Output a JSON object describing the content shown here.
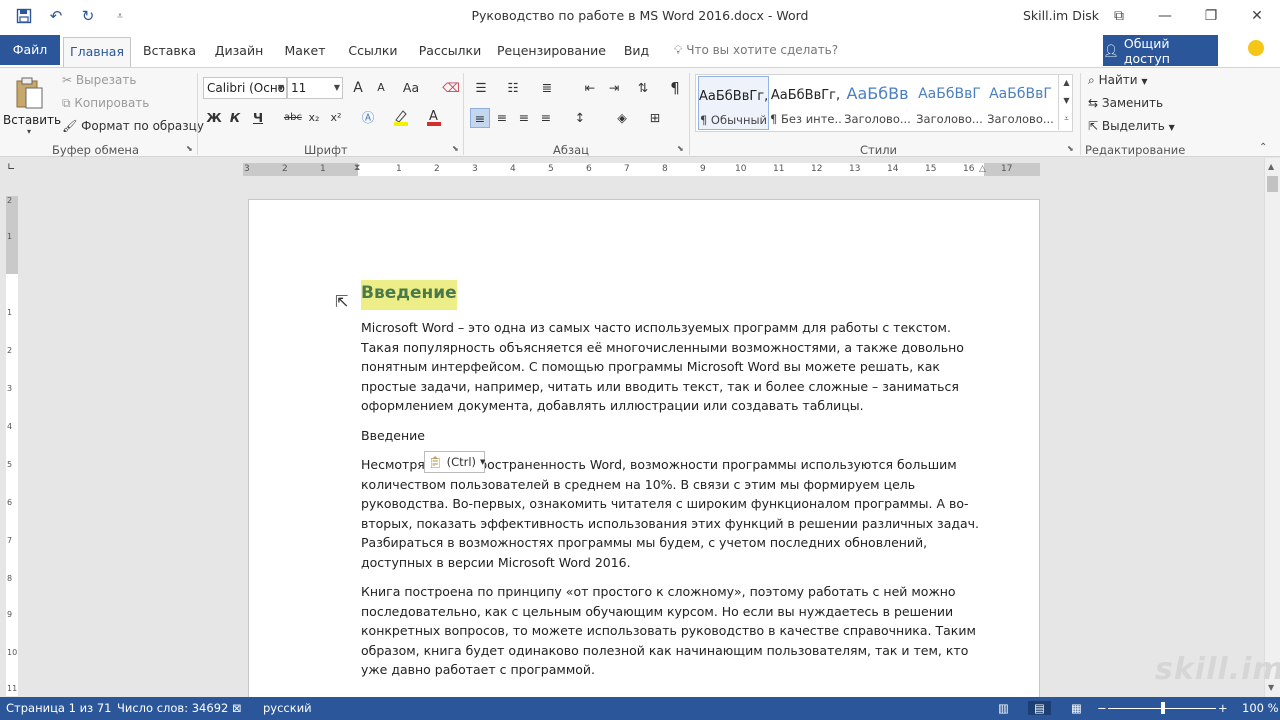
{
  "window": {
    "title": "Руководство по работе в MS Word 2016.docx - Word",
    "account": "Skill.im Disk",
    "controls": [
      "⧉",
      "—",
      "❐",
      "✕"
    ]
  },
  "qat": [
    "save-icon",
    "undo-icon",
    "redo-icon",
    "customize-icon"
  ],
  "tabs": {
    "file": "Файл",
    "home": "Главная",
    "insert": "Вставка",
    "design": "Дизайн",
    "layout": "Макет",
    "references": "Ссылки",
    "mailings": "Рассылки",
    "review": "Рецензирование",
    "view": "Вид",
    "tellme": "Что вы хотите сделать?",
    "share": "Общий доступ"
  },
  "clipboard": {
    "paste": "Вставить",
    "cut": "Вырезать",
    "copy": "Копировать",
    "format_painter": "Формат по образцу",
    "label": "Буфер обмена"
  },
  "font": {
    "name": "Calibri (Осно",
    "size": "11",
    "bold": "Ж",
    "italic": "К",
    "underline": "Ч",
    "strike": "abc",
    "subscript": "x₂",
    "superscript": "x²",
    "grow": "A",
    "shrink": "A",
    "case": "Aa",
    "label": "Шрифт"
  },
  "paragraph": {
    "label": "Абзац",
    "pilcrow": "¶"
  },
  "styles": {
    "label": "Стили",
    "items": [
      {
        "preview": "АаБбВвГг,",
        "name": "¶ Обычный"
      },
      {
        "preview": "АаБбВвГг,",
        "name": "¶ Без инте..."
      },
      {
        "preview": "АаБбВв",
        "name": "Заголово..."
      },
      {
        "preview": "АаБбВвГ",
        "name": "Заголово..."
      },
      {
        "preview": "АаБбВвГ",
        "name": "Заголово..."
      }
    ]
  },
  "editing": {
    "find": "Найти",
    "replace": "Заменить",
    "select": "Выделить",
    "label": "Редактирование"
  },
  "ruler": {
    "numbers": [
      "3",
      "2",
      "1",
      "1",
      "2",
      "3",
      "4",
      "5",
      "6",
      "7",
      "8",
      "9",
      "10",
      "11",
      "12",
      "13",
      "14",
      "15",
      "16",
      "17"
    ],
    "vnumbers": [
      "2",
      "1",
      "1",
      "2",
      "3",
      "4",
      "5",
      "6",
      "7",
      "8",
      "9",
      "10",
      "11"
    ]
  },
  "document": {
    "heading": "Введение",
    "p1": "Microsoft Word – это одна из самых часто используемых программ для работы с текстом. Такая популярность объясняется её многочисленными возможностями, а также довольно понятным интерфейсом. С помощью программы Microsoft Word вы можете решать, как простые задачи, например, читать или вводить текст, так и более сложные – заниматься оформлением документа, добавлять иллюстрации или создавать таблицы.",
    "p2": "Введение",
    "p3": "Несмотря на распространенность Word, возможности программы используются большим количеством пользователей в среднем на 10%. В связи с этим мы формируем цель руководства. Во-первых, ознакомить читателя с широким функционалом программы. А во-вторых, показать эффективность использования этих функций в решении различных задач. Разбираться в возможностях программы мы будем, с учетом последних обновлений, доступных в версии Microsoft Word 2016.",
    "p4": "Книга построена по принципу «от простого к сложному», поэтому работать с ней можно последовательно, как с цельным обучающим курсом. Но если вы нуждаетесь в решении конкретных вопросов, то можете использовать руководство в качестве справочника. Таким образом, книга будет одинаково полезной как начинающим пользователям, так и тем, кто уже давно работает с программой.",
    "paste_options": "(Ctrl)"
  },
  "watermark": "skill.im",
  "status": {
    "page": "Страница 1 из 71",
    "words": "Число слов: 34692",
    "language": "русский",
    "zoom": "100 %"
  },
  "colors": {
    "accent": "#2b579a",
    "heading_highlight": "#eeee88",
    "heading_text": "#4a7a4a"
  }
}
